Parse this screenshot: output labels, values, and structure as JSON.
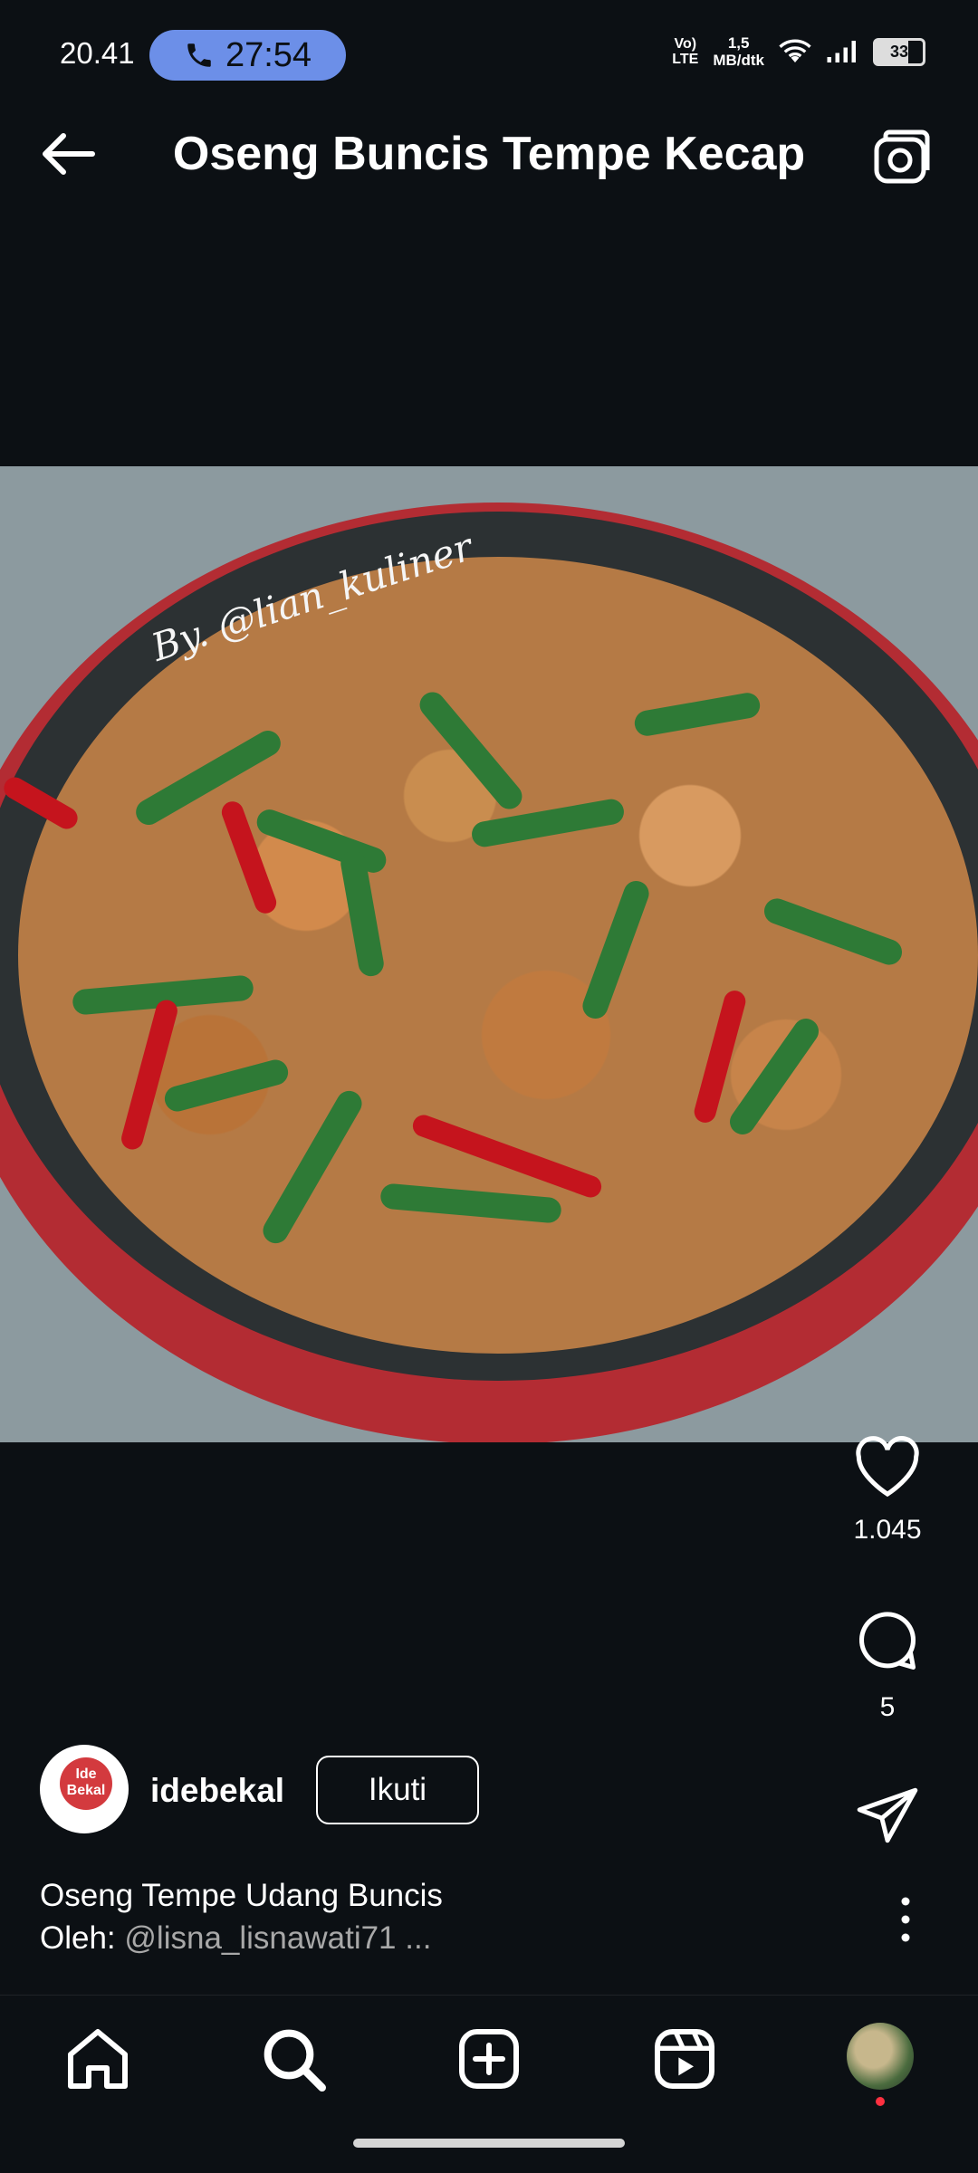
{
  "status_bar": {
    "time": "20.41",
    "call_duration": "27:54",
    "network_type_top": "Vo)",
    "network_type_bottom": "LTE",
    "speed_value": "1,5",
    "speed_unit": "MB/dtk",
    "battery": "33"
  },
  "header": {
    "title": "Oseng Buncis Tempe Kecap",
    "back_icon": "arrow-left-icon",
    "camera_icon": "camera-icon"
  },
  "post": {
    "watermark": "By. @lian_kuliner",
    "likes": "1.045",
    "comments": "5",
    "like_icon": "heart-icon",
    "comment_icon": "comment-bubble-icon",
    "share_icon": "paper-plane-icon",
    "more_icon": "more-vertical-icon"
  },
  "author": {
    "avatar_line1": "Ide",
    "avatar_line2": "Bekal",
    "username": "idebekal",
    "follow_label": "Ikuti"
  },
  "caption": {
    "line1": "Oseng Tempe Udang Buncis",
    "prefix": "Oleh: ",
    "mention": "@lisna_lisnawati71 ..."
  },
  "bottom_nav": {
    "items": [
      "home-icon",
      "search-icon",
      "create-icon",
      "reels-icon",
      "profile-avatar"
    ]
  },
  "colors": {
    "background": "#0c1014",
    "call_pill": "#6c8fe8",
    "notification_dot": "#ff3040"
  }
}
